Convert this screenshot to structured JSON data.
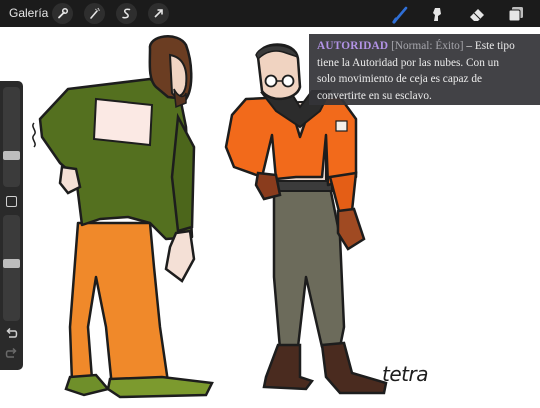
{
  "toolbar": {
    "gallery_label": "Galería",
    "left_tools": [
      {
        "icon": "wrench-icon",
        "name": "actions"
      },
      {
        "icon": "magic-wand-icon",
        "name": "adjustments"
      },
      {
        "icon": "selection-icon",
        "name": "selection"
      },
      {
        "icon": "transform-arrow-icon",
        "name": "transform"
      }
    ],
    "right_tools": [
      {
        "icon": "brush-icon",
        "name": "brush",
        "active": true
      },
      {
        "icon": "smudge-icon",
        "name": "smudge"
      },
      {
        "icon": "eraser-icon",
        "name": "eraser"
      },
      {
        "icon": "layers-icon",
        "name": "layers"
      }
    ],
    "active_color": "#2f6fd6"
  },
  "sidebar": {
    "brush_size_level": 0.3,
    "opacity_level": 0.55
  },
  "tooltip": {
    "skill": "AUTORIDAD",
    "check": "[Normal: Éxito]",
    "dash": " – ",
    "line1_text": "Este tipo",
    "line2": "tiene la Autoridad por las nubes. Con un",
    "line3": "solo movimiento de ceja es capaz de",
    "line4": "convertirte en su esclavo."
  },
  "artwork": {
    "signature": "tetra"
  }
}
